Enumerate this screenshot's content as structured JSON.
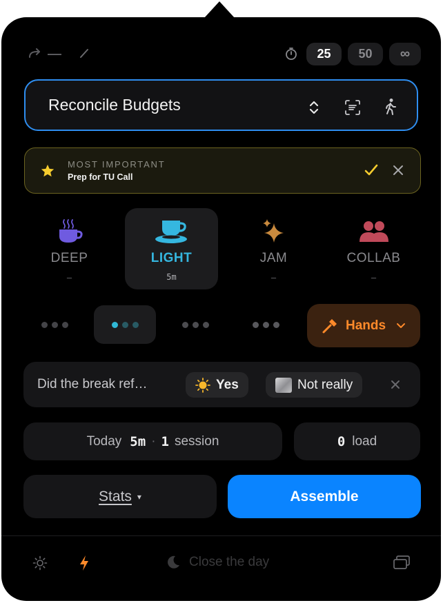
{
  "toolbar": {
    "durations": [
      "25",
      "50",
      "∞"
    ],
    "active_duration": "25"
  },
  "task": {
    "title": "Reconcile Budgets"
  },
  "most_important": {
    "heading": "MOST IMPORTANT",
    "text": "Prep for TU Call"
  },
  "modes": [
    {
      "label": "DEEP",
      "sub": "–",
      "icon": "hot-coffee-icon",
      "color": "#6f5be0"
    },
    {
      "label": "LIGHT",
      "sub": "5m",
      "icon": "teacup-icon",
      "color": "#35b7e0",
      "active": true
    },
    {
      "label": "JAM",
      "sub": "–",
      "icon": "sparkles-icon",
      "color": "#c98a3e"
    },
    {
      "label": "COLLAB",
      "sub": "–",
      "icon": "people-icon",
      "color": "#c04a5a"
    }
  ],
  "hands": {
    "label": "Hands",
    "color": "#ff8a2a"
  },
  "break_question": {
    "text": "Did the break ref…",
    "yes_label": "Yes",
    "no_label": "Not really"
  },
  "today": {
    "prefix": "Today",
    "minutes": "5m",
    "separator": "·",
    "sessions": "1",
    "sessions_label": "session"
  },
  "load": {
    "value": "0",
    "label": "load"
  },
  "stats_label": "Stats",
  "assemble_label": "Assemble",
  "footer": {
    "close_day": "Close the day"
  },
  "colors": {
    "accent_blue": "#0a84ff",
    "task_border": "#2f8ef0",
    "gold": "#f5cc2e",
    "panel": "#000000"
  }
}
